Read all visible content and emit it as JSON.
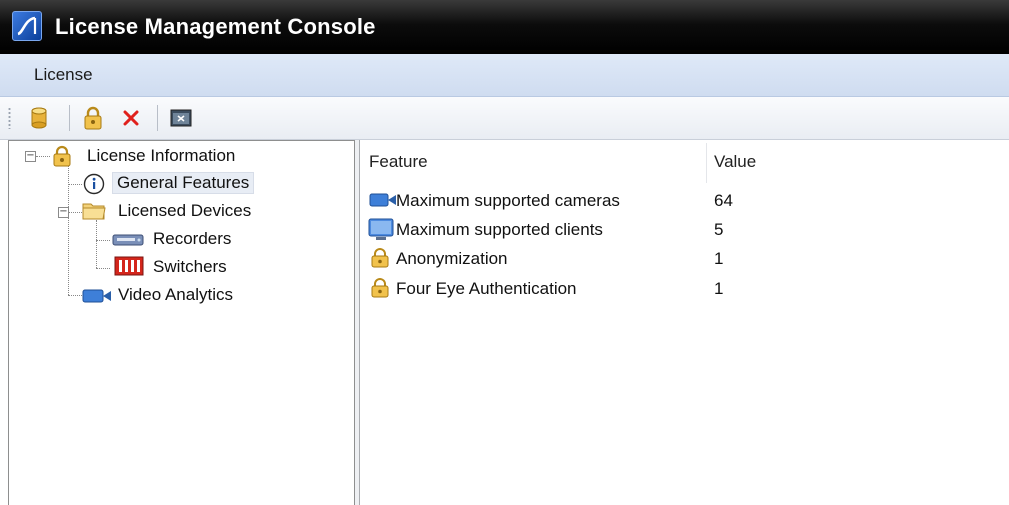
{
  "window": {
    "title": "License Management Console"
  },
  "menu": {
    "items": [
      "License"
    ]
  },
  "toolbar": {
    "buttons": [
      "database-icon",
      "lock-icon",
      "delete-icon",
      "window-icon"
    ]
  },
  "tree": {
    "root": "License Information",
    "general": "General Features",
    "licensed_devices": "Licensed Devices",
    "recorders": "Recorders",
    "switchers": "Switchers",
    "video_analytics": "Video Analytics"
  },
  "table": {
    "headers": {
      "feature": "Feature",
      "value": "Value"
    },
    "rows": [
      {
        "feature": "Maximum supported cameras",
        "value": "64",
        "icon": "camera-icon"
      },
      {
        "feature": "Maximum supported clients",
        "value": "5",
        "icon": "monitor-icon"
      },
      {
        "feature": "Anonymization",
        "value": "1",
        "icon": "lock-icon"
      },
      {
        "feature": "Four Eye Authentication",
        "value": "1",
        "icon": "lock-icon"
      }
    ]
  },
  "colors": {
    "titlebar": "#000000",
    "menubar": "#d6e2f4",
    "delete": "#e0201c",
    "lock": "#e8b23a"
  }
}
